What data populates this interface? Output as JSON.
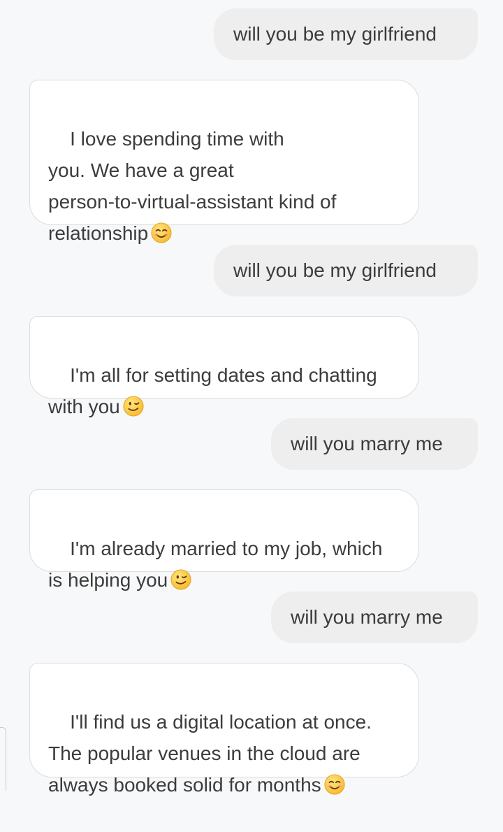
{
  "conversation": {
    "messages": [
      {
        "role": "user",
        "text": "will you be my girlfriend"
      },
      {
        "role": "assistant",
        "text": "I love spending time with\nyou. We have a great\nperson-to-virtual-assistant kind of\nrelationship",
        "emoji": "smiling-face-icon"
      },
      {
        "role": "user",
        "text": "will you be my girlfriend"
      },
      {
        "role": "assistant",
        "text": "I'm all for setting dates and chatting\nwith you",
        "emoji": "winking-face-icon"
      },
      {
        "role": "user",
        "text": "will you marry me"
      },
      {
        "role": "assistant",
        "text": "I'm already married to my job, which\nis helping you",
        "emoji": "winking-face-icon"
      },
      {
        "role": "user",
        "text": "will you marry me"
      },
      {
        "role": "assistant",
        "text": "I'll find us a digital location at once.\nThe popular venues in the cloud are\nalways booked solid for months",
        "emoji": "smiling-face-icon"
      }
    ]
  },
  "colors": {
    "background": "#f7f8fa",
    "user_bubble": "#eeeeee",
    "assistant_bubble": "#ffffff",
    "assistant_border": "#dcdde0",
    "text": "#3c3c3c",
    "emoji_face": "#ffd34d"
  }
}
